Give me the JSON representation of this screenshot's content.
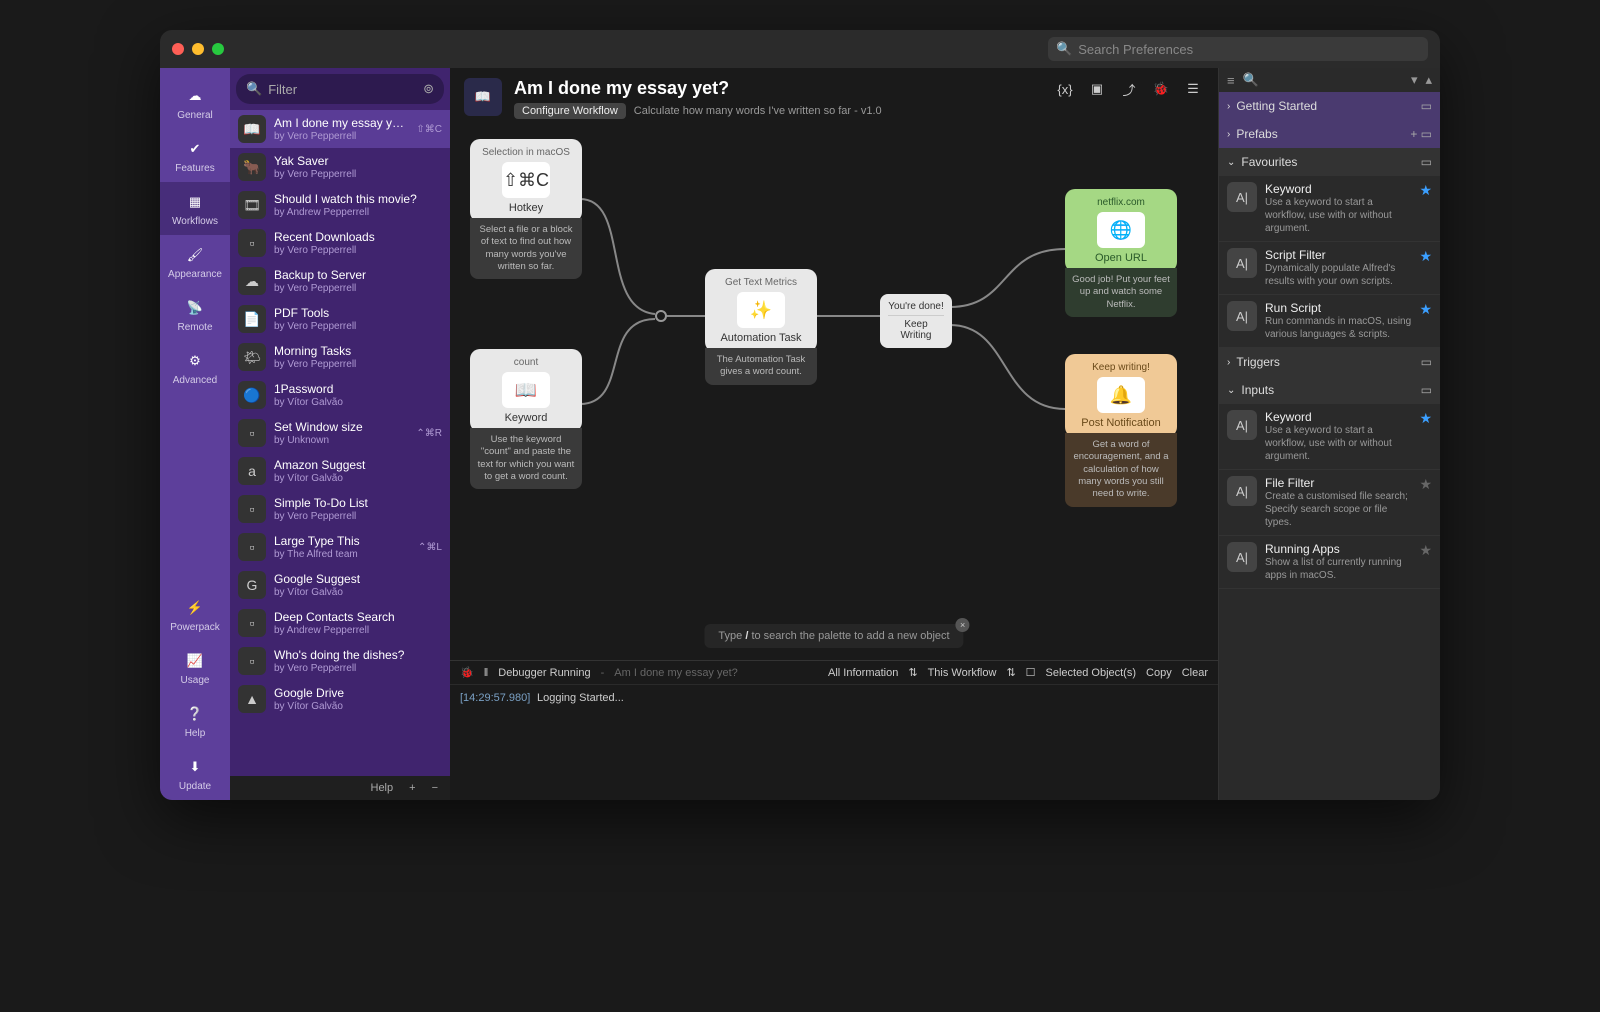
{
  "search_placeholder": "Search Preferences",
  "nav": [
    {
      "label": "General"
    },
    {
      "label": "Features"
    },
    {
      "label": "Workflows"
    },
    {
      "label": "Appearance"
    },
    {
      "label": "Remote"
    },
    {
      "label": "Advanced"
    },
    {
      "label": "Powerpack"
    },
    {
      "label": "Usage"
    },
    {
      "label": "Help"
    },
    {
      "label": "Update"
    }
  ],
  "filter_placeholder": "Filter",
  "workflows": [
    {
      "name": "Am I done my essay yet?",
      "author": "by Vero Pepperrell",
      "shortcut": "⇧⌘C",
      "sel": true,
      "ico": "📖"
    },
    {
      "name": "Yak Saver",
      "author": "by Vero Pepperrell",
      "ico": "🐂"
    },
    {
      "name": "Should I watch this movie?",
      "author": "by Andrew Pepperrell",
      "ico": "🎞"
    },
    {
      "name": "Recent Downloads",
      "author": "by Vero Pepperrell",
      "ico": "▫"
    },
    {
      "name": "Backup to Server",
      "author": "by Vero Pepperrell",
      "ico": "☁"
    },
    {
      "name": "PDF Tools",
      "author": "by Vero Pepperrell",
      "ico": "📄"
    },
    {
      "name": "Morning Tasks",
      "author": "by Vero Pepperrell",
      "ico": "🌤"
    },
    {
      "name": "1Password",
      "author": "by Vítor Galvão",
      "ico": "🔵"
    },
    {
      "name": "Set Window size",
      "author": "by Unknown",
      "shortcut": "⌃⌘R",
      "ico": "▫"
    },
    {
      "name": "Amazon Suggest",
      "author": "by Vítor Galvão",
      "ico": "a"
    },
    {
      "name": "Simple To-Do List",
      "author": "by Vero Pepperrell",
      "ico": "▫"
    },
    {
      "name": "Large Type This",
      "author": "by The Alfred team",
      "shortcut": "⌃⌘L",
      "ico": "▫"
    },
    {
      "name": "Google Suggest",
      "author": "by Vítor Galvão",
      "ico": "G"
    },
    {
      "name": "Deep Contacts Search",
      "author": "by Andrew Pepperrell",
      "ico": "▫"
    },
    {
      "name": "Who's doing the dishes?",
      "author": "by Vero Pepperrell",
      "ico": "▫"
    },
    {
      "name": "Google Drive",
      "author": "by Vítor Galvão",
      "ico": "▲"
    }
  ],
  "wf_help": "Help",
  "header": {
    "title": "Am I done my essay yet?",
    "configure": "Configure Workflow",
    "desc": "Calculate how many words I've written so far - v1.0"
  },
  "nodes": {
    "hotkey": {
      "lbl": "Selection in macOS",
      "key": "⇧⌘C",
      "ttl": "Hotkey",
      "desc": "Select a file or a block of text to find out how many words you've written so far."
    },
    "keyword": {
      "lbl": "count",
      "ttl": "Keyword",
      "desc": "Use the keyword \"count\" and paste the text for which you want to get a word count."
    },
    "auto": {
      "lbl": "Get Text Metrics",
      "ttl": "Automation Task",
      "desc": "The Automation Task gives a word count."
    },
    "opts": {
      "a": "You're done!",
      "b": "Keep Writing"
    },
    "url": {
      "lbl": "netflix.com",
      "ttl": "Open URL",
      "desc": "Good job! Put your feet up and watch some Netflix."
    },
    "notif": {
      "lbl": "Keep writing!",
      "ttl": "Post Notification",
      "desc": "Get a word of encouragement, and a calculation of how many words you still need to write."
    }
  },
  "palette_hint_a": "Type ",
  "palette_hint_slash": "/",
  "palette_hint_b": " to search the palette to add a new object",
  "dbg": {
    "status": "Debugger Running",
    "wf": "Am I done my essay yet?",
    "filter1": "All Information",
    "filter2": "This Workflow",
    "sel": "Selected Object(s)",
    "copy": "Copy",
    "clear": "Clear",
    "ts": "[14:29:57.980]",
    "msg": "Logging Started..."
  },
  "panel": {
    "cats": {
      "start": "Getting Started",
      "prefabs": "Prefabs",
      "fav": "Favourites",
      "trig": "Triggers",
      "inp": "Inputs"
    },
    "items": [
      {
        "name": "Keyword",
        "desc": "Use a keyword to start a workflow, use with or without argument.",
        "star": "blue"
      },
      {
        "name": "Script Filter",
        "desc": "Dynamically populate Alfred's results with your own scripts.",
        "star": "blue"
      },
      {
        "name": "Run Script",
        "desc": "Run commands in macOS, using various languages & scripts.",
        "star": "blue"
      }
    ],
    "items2": [
      {
        "name": "Keyword",
        "desc": "Use a keyword to start a workflow, use with or without argument.",
        "star": "blue"
      },
      {
        "name": "File Filter",
        "desc": "Create a customised file search; Specify search scope or file types.",
        "star": "grey"
      },
      {
        "name": "Running Apps",
        "desc": "Show a list of currently running apps in macOS.",
        "star": "grey"
      }
    ]
  }
}
